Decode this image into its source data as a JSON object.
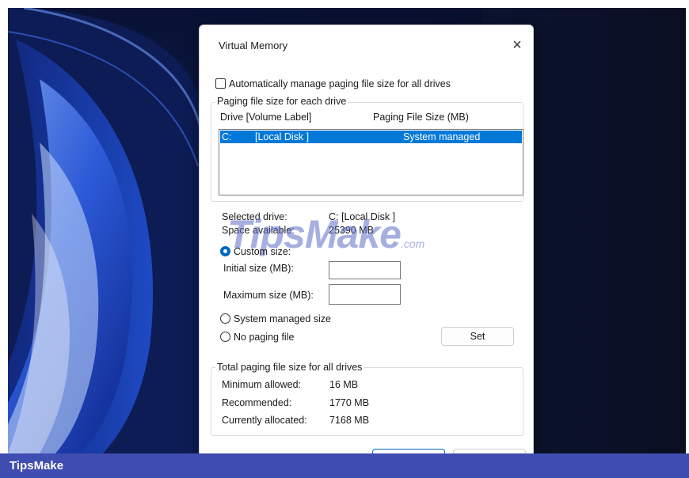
{
  "dialog": {
    "title": "Virtual Memory",
    "close_glyph": "×",
    "auto_manage_label": "Automatically manage paging file size for all drives",
    "paging_group_label": "Paging file size for each drive",
    "col_drive": "Drive  [Volume Label]",
    "col_size": "Paging File Size (MB)",
    "drives": [
      {
        "drive": "C:",
        "label": "[Local Disk ]",
        "size": "System managed"
      }
    ],
    "selected_drive_label": "Selected drive:",
    "selected_drive_value": "C:  [Local Disk ]",
    "space_available_label": "Space available:",
    "space_available_value": "25390 MB",
    "custom_size_label": "Custom size:",
    "initial_size_label": "Initial size (MB):",
    "initial_size_value": "",
    "maximum_size_label": "Maximum size (MB):",
    "maximum_size_value": "",
    "system_managed_label": "System managed size",
    "no_paging_label": "No paging file",
    "set_label": "Set",
    "total_group_label": "Total paging file size for all drives",
    "minimum_allowed_label": "Minimum allowed:",
    "minimum_allowed_value": "16 MB",
    "recommended_label": "Recommended:",
    "recommended_value": "1770 MB",
    "currently_allocated_label": "Currently allocated:",
    "currently_allocated_value": "7168 MB"
  },
  "watermark": {
    "main": "TipsMake",
    "suffix": ".com"
  },
  "brand_bar": {
    "text": "TipsMake"
  },
  "colors": {
    "accent": "#0078d7",
    "brand_bar": "#3f4cb0"
  }
}
